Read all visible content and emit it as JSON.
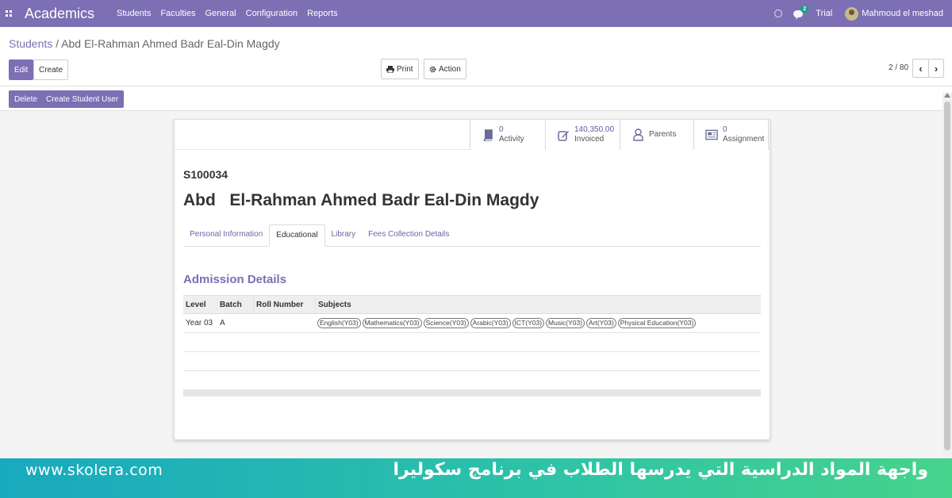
{
  "navbar": {
    "brand": "Academics",
    "menu": [
      "Students",
      "Faculties",
      "General",
      "Configuration",
      "Reports"
    ],
    "notification_count": "2",
    "trial": "Trial",
    "user_name": "Mahmoud el meshad"
  },
  "breadcrumb": {
    "parent": "Students",
    "separator": " / ",
    "current": "Abd El-Rahman Ahmed Badr Eal-Din Magdy"
  },
  "buttons": {
    "edit": "Edit",
    "create": "Create",
    "print": "Print",
    "action": "Action",
    "delete": "Delete",
    "create_student_user": "Create Student User"
  },
  "pager": {
    "text": "2 / 80"
  },
  "smart_buttons": [
    {
      "value": "0",
      "label": "Activity",
      "icon": "book-icon"
    },
    {
      "value": "140,350.00",
      "label": "Invoiced",
      "icon": "pencil-square-icon"
    },
    {
      "value": "",
      "label": "Parents",
      "icon": "user-icon"
    },
    {
      "value": "0",
      "label": "Assignment",
      "icon": "newspaper-icon"
    }
  ],
  "student": {
    "ref": "S100034",
    "name": "Abd   El-Rahman Ahmed Badr Eal-Din Magdy"
  },
  "tabs": [
    {
      "label": "Personal Information",
      "active": false
    },
    {
      "label": "Educational",
      "active": true
    },
    {
      "label": "Library",
      "active": false
    },
    {
      "label": "Fees Collection Details",
      "active": false
    }
  ],
  "admission": {
    "title": "Admission Details",
    "columns": [
      "Level",
      "Batch",
      "Roll Number",
      "Subjects"
    ],
    "rows": [
      {
        "level": "Year 03",
        "batch": "A",
        "roll_number": "",
        "subjects": [
          "English(Y03)",
          "Mathematics(Y03)",
          "Science(Y03)",
          "Arabic(Y03)",
          "ICT(Y03)",
          "Music(Y03)",
          "Art(Y03)",
          "Physical Education(Y03)"
        ]
      }
    ]
  },
  "banner": {
    "url": "www.skolera.com",
    "caption": "واجهة المواد الدراسية التي يدرسها الطلاب في برنامج سكوليرا"
  },
  "colors": {
    "navbar": "#7c6fb4",
    "primary_button": "#7c6fb4",
    "section_title": "#7c6fb4",
    "banner_start": "#18a9bf",
    "banner_end": "#46d38c"
  }
}
